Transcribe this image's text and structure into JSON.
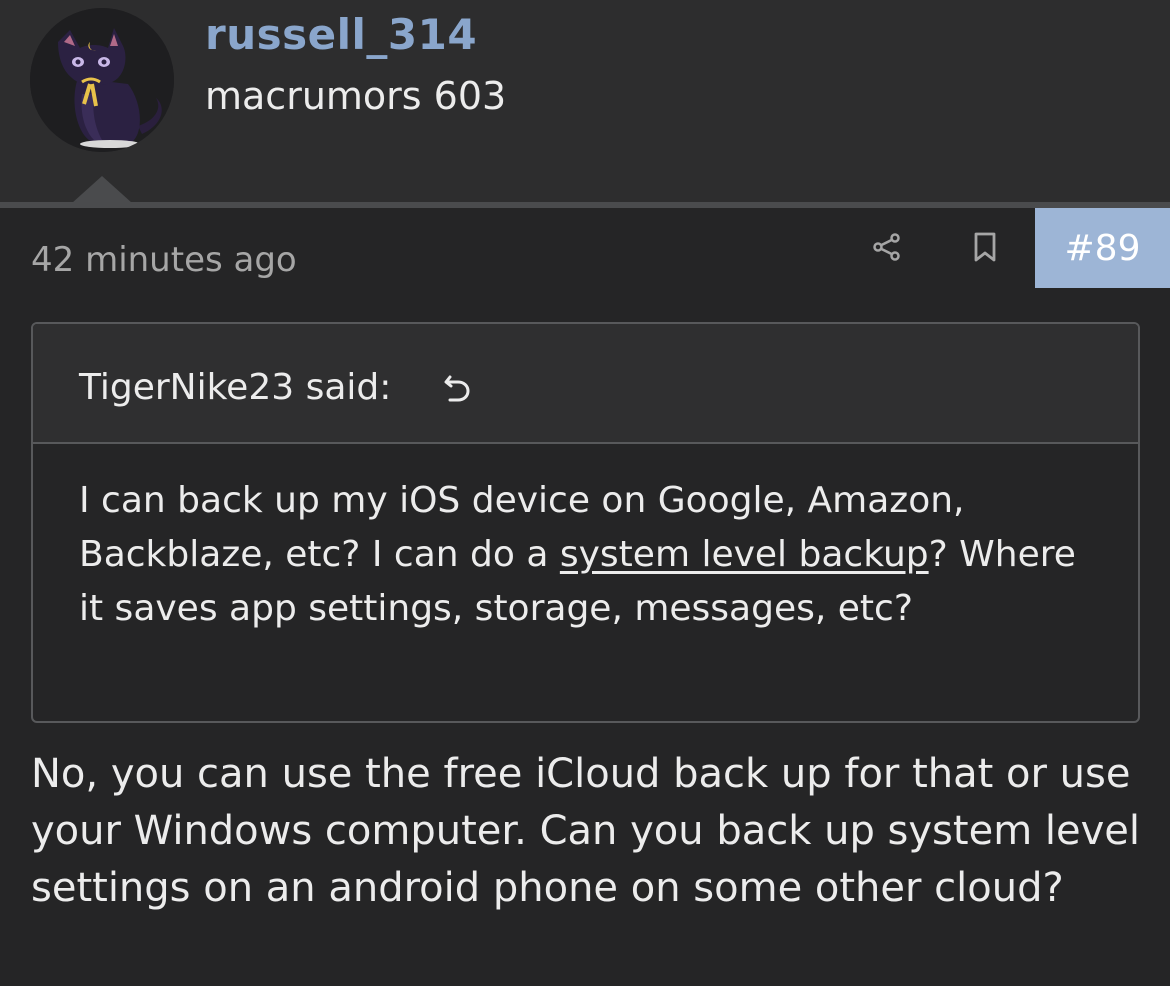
{
  "user": {
    "username": "russell_314",
    "title": "macrumors 603"
  },
  "post": {
    "timestamp": "42 minutes ago",
    "number": "#89"
  },
  "quote": {
    "author_said": "TigerNike23 said:",
    "text_before": "I can back up my iOS device on Google, Amazon, Backblaze, etc? I can do a ",
    "link_text": "system level backup",
    "text_after": "? Where it saves app settings, storage, messages, etc?"
  },
  "reply": {
    "text": "No, you can use the free iCloud back up for that or use your Windows computer. Can you back up system level settings on an android phone on some other cloud?"
  },
  "icons": {
    "share": "share-icon",
    "bookmark": "bookmark-icon",
    "quote_jump": "return-arrow-icon"
  },
  "colors": {
    "background": "#252526",
    "header_background": "#2d2d2e",
    "username": "#8aa6cc",
    "post_number_background": "#9db5d6",
    "border": "#58595b"
  }
}
